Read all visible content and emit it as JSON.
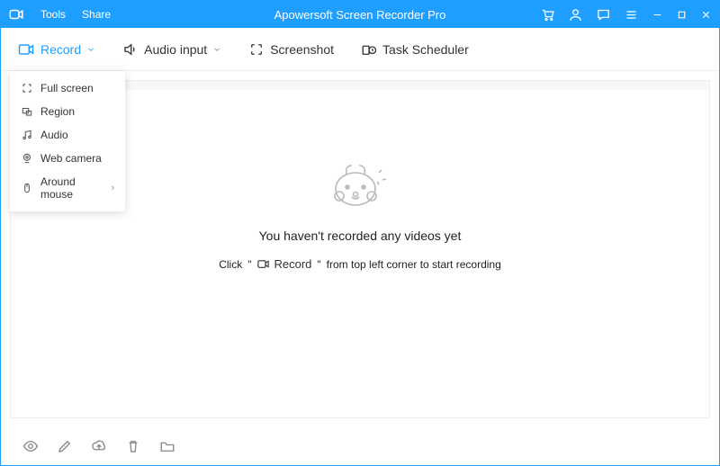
{
  "titlebar": {
    "tools": "Tools",
    "share": "Share",
    "app_title": "Apowersoft Screen Recorder Pro"
  },
  "toolbar": {
    "record": "Record",
    "audio_input": "Audio input",
    "screenshot": "Screenshot",
    "task_scheduler": "Task Scheduler"
  },
  "dropdown": {
    "full_screen": "Full screen",
    "region": "Region",
    "audio": "Audio",
    "web_camera": "Web camera",
    "around_mouse": "Around mouse"
  },
  "empty": {
    "headline": "You haven't recorded any videos yet",
    "click": "Click",
    "quote_l": "\"",
    "quote_r": "\"",
    "record_label": "Record",
    "tail": "from top left corner to start recording"
  }
}
